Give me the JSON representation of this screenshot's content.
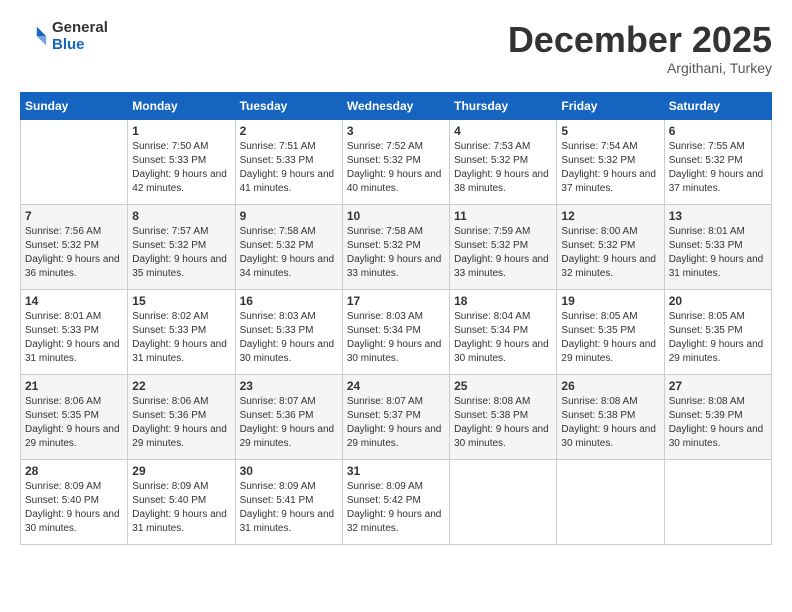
{
  "header": {
    "logo_general": "General",
    "logo_blue": "Blue",
    "month_title": "December 2025",
    "subtitle": "Argithani, Turkey"
  },
  "days_of_week": [
    "Sunday",
    "Monday",
    "Tuesday",
    "Wednesday",
    "Thursday",
    "Friday",
    "Saturday"
  ],
  "weeks": [
    [
      {
        "day": "",
        "sunrise": "",
        "sunset": "",
        "daylight": ""
      },
      {
        "day": "1",
        "sunrise": "Sunrise: 7:50 AM",
        "sunset": "Sunset: 5:33 PM",
        "daylight": "Daylight: 9 hours and 42 minutes."
      },
      {
        "day": "2",
        "sunrise": "Sunrise: 7:51 AM",
        "sunset": "Sunset: 5:33 PM",
        "daylight": "Daylight: 9 hours and 41 minutes."
      },
      {
        "day": "3",
        "sunrise": "Sunrise: 7:52 AM",
        "sunset": "Sunset: 5:32 PM",
        "daylight": "Daylight: 9 hours and 40 minutes."
      },
      {
        "day": "4",
        "sunrise": "Sunrise: 7:53 AM",
        "sunset": "Sunset: 5:32 PM",
        "daylight": "Daylight: 9 hours and 38 minutes."
      },
      {
        "day": "5",
        "sunrise": "Sunrise: 7:54 AM",
        "sunset": "Sunset: 5:32 PM",
        "daylight": "Daylight: 9 hours and 37 minutes."
      },
      {
        "day": "6",
        "sunrise": "Sunrise: 7:55 AM",
        "sunset": "Sunset: 5:32 PM",
        "daylight": "Daylight: 9 hours and 37 minutes."
      }
    ],
    [
      {
        "day": "7",
        "sunrise": "Sunrise: 7:56 AM",
        "sunset": "Sunset: 5:32 PM",
        "daylight": "Daylight: 9 hours and 36 minutes."
      },
      {
        "day": "8",
        "sunrise": "Sunrise: 7:57 AM",
        "sunset": "Sunset: 5:32 PM",
        "daylight": "Daylight: 9 hours and 35 minutes."
      },
      {
        "day": "9",
        "sunrise": "Sunrise: 7:58 AM",
        "sunset": "Sunset: 5:32 PM",
        "daylight": "Daylight: 9 hours and 34 minutes."
      },
      {
        "day": "10",
        "sunrise": "Sunrise: 7:58 AM",
        "sunset": "Sunset: 5:32 PM",
        "daylight": "Daylight: 9 hours and 33 minutes."
      },
      {
        "day": "11",
        "sunrise": "Sunrise: 7:59 AM",
        "sunset": "Sunset: 5:32 PM",
        "daylight": "Daylight: 9 hours and 33 minutes."
      },
      {
        "day": "12",
        "sunrise": "Sunrise: 8:00 AM",
        "sunset": "Sunset: 5:32 PM",
        "daylight": "Daylight: 9 hours and 32 minutes."
      },
      {
        "day": "13",
        "sunrise": "Sunrise: 8:01 AM",
        "sunset": "Sunset: 5:33 PM",
        "daylight": "Daylight: 9 hours and 31 minutes."
      }
    ],
    [
      {
        "day": "14",
        "sunrise": "Sunrise: 8:01 AM",
        "sunset": "Sunset: 5:33 PM",
        "daylight": "Daylight: 9 hours and 31 minutes."
      },
      {
        "day": "15",
        "sunrise": "Sunrise: 8:02 AM",
        "sunset": "Sunset: 5:33 PM",
        "daylight": "Daylight: 9 hours and 31 minutes."
      },
      {
        "day": "16",
        "sunrise": "Sunrise: 8:03 AM",
        "sunset": "Sunset: 5:33 PM",
        "daylight": "Daylight: 9 hours and 30 minutes."
      },
      {
        "day": "17",
        "sunrise": "Sunrise: 8:03 AM",
        "sunset": "Sunset: 5:34 PM",
        "daylight": "Daylight: 9 hours and 30 minutes."
      },
      {
        "day": "18",
        "sunrise": "Sunrise: 8:04 AM",
        "sunset": "Sunset: 5:34 PM",
        "daylight": "Daylight: 9 hours and 30 minutes."
      },
      {
        "day": "19",
        "sunrise": "Sunrise: 8:05 AM",
        "sunset": "Sunset: 5:35 PM",
        "daylight": "Daylight: 9 hours and 29 minutes."
      },
      {
        "day": "20",
        "sunrise": "Sunrise: 8:05 AM",
        "sunset": "Sunset: 5:35 PM",
        "daylight": "Daylight: 9 hours and 29 minutes."
      }
    ],
    [
      {
        "day": "21",
        "sunrise": "Sunrise: 8:06 AM",
        "sunset": "Sunset: 5:35 PM",
        "daylight": "Daylight: 9 hours and 29 minutes."
      },
      {
        "day": "22",
        "sunrise": "Sunrise: 8:06 AM",
        "sunset": "Sunset: 5:36 PM",
        "daylight": "Daylight: 9 hours and 29 minutes."
      },
      {
        "day": "23",
        "sunrise": "Sunrise: 8:07 AM",
        "sunset": "Sunset: 5:36 PM",
        "daylight": "Daylight: 9 hours and 29 minutes."
      },
      {
        "day": "24",
        "sunrise": "Sunrise: 8:07 AM",
        "sunset": "Sunset: 5:37 PM",
        "daylight": "Daylight: 9 hours and 29 minutes."
      },
      {
        "day": "25",
        "sunrise": "Sunrise: 8:08 AM",
        "sunset": "Sunset: 5:38 PM",
        "daylight": "Daylight: 9 hours and 30 minutes."
      },
      {
        "day": "26",
        "sunrise": "Sunrise: 8:08 AM",
        "sunset": "Sunset: 5:38 PM",
        "daylight": "Daylight: 9 hours and 30 minutes."
      },
      {
        "day": "27",
        "sunrise": "Sunrise: 8:08 AM",
        "sunset": "Sunset: 5:39 PM",
        "daylight": "Daylight: 9 hours and 30 minutes."
      }
    ],
    [
      {
        "day": "28",
        "sunrise": "Sunrise: 8:09 AM",
        "sunset": "Sunset: 5:40 PM",
        "daylight": "Daylight: 9 hours and 30 minutes."
      },
      {
        "day": "29",
        "sunrise": "Sunrise: 8:09 AM",
        "sunset": "Sunset: 5:40 PM",
        "daylight": "Daylight: 9 hours and 31 minutes."
      },
      {
        "day": "30",
        "sunrise": "Sunrise: 8:09 AM",
        "sunset": "Sunset: 5:41 PM",
        "daylight": "Daylight: 9 hours and 31 minutes."
      },
      {
        "day": "31",
        "sunrise": "Sunrise: 8:09 AM",
        "sunset": "Sunset: 5:42 PM",
        "daylight": "Daylight: 9 hours and 32 minutes."
      },
      {
        "day": "",
        "sunrise": "",
        "sunset": "",
        "daylight": ""
      },
      {
        "day": "",
        "sunrise": "",
        "sunset": "",
        "daylight": ""
      },
      {
        "day": "",
        "sunrise": "",
        "sunset": "",
        "daylight": ""
      }
    ]
  ]
}
